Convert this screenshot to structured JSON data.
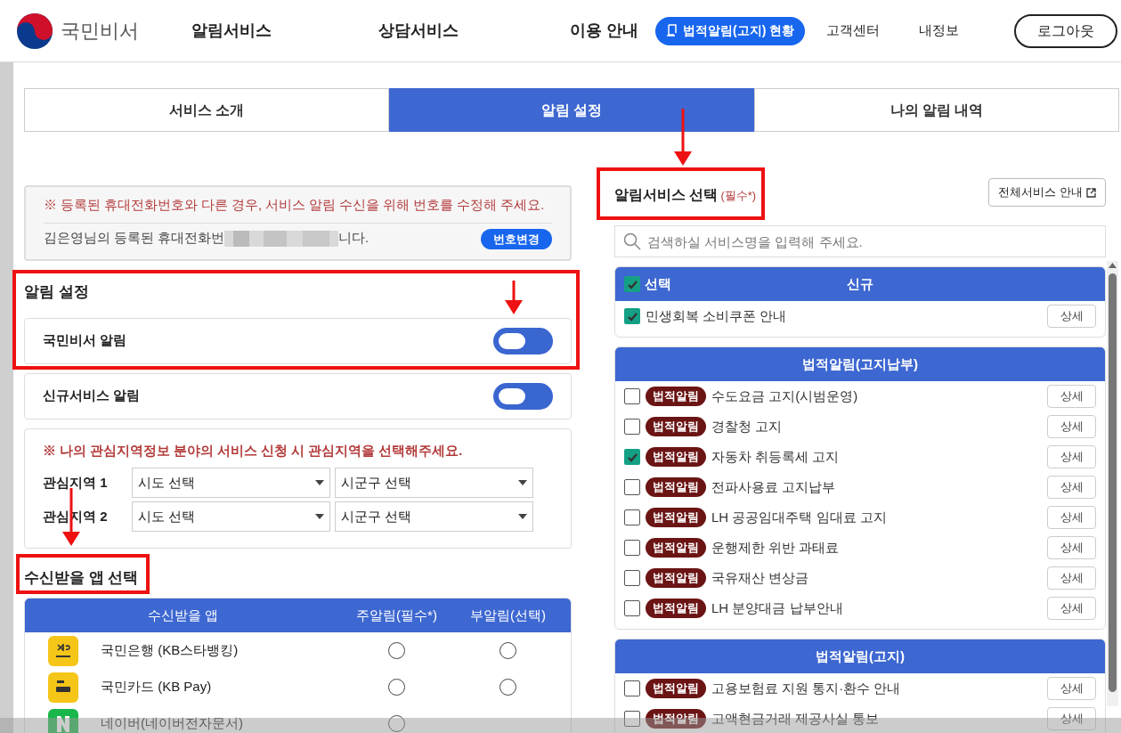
{
  "header": {
    "logo_text": "국민비서",
    "nav": [
      {
        "label": "알림서비스"
      },
      {
        "label": "상담서비스"
      },
      {
        "label": "이용 안내"
      }
    ],
    "status_button": "법적알림(고지) 현황",
    "links": [
      "고객센터",
      "내정보"
    ],
    "logout": "로그아웃"
  },
  "tabs": [
    {
      "label": "서비스 소개",
      "selected": false
    },
    {
      "label": "알림 설정",
      "selected": true
    },
    {
      "label": "나의 알림 내역",
      "selected": false
    }
  ],
  "phone_notice": {
    "warning": "※ 등록된 휴대전화번호와 다른 경우, 서비스 알림 수신을 위해 번호를 수정해 주세요.",
    "text_before": "김은영님의 등록된 휴대전화번",
    "text_after": "니다.",
    "change_button": "번호변경"
  },
  "alert_settings": {
    "title": "알림 설정",
    "toggles": [
      {
        "label": "국민비서 알림",
        "on": false
      },
      {
        "label": "신규서비스 알림",
        "on": false
      }
    ]
  },
  "region": {
    "warning": "※ 나의 관심지역정보 분야의 서비스 신청 시 관심지역을 선택해주세요.",
    "rows": [
      {
        "label": "관심지역 1",
        "selects": [
          "시도 선택",
          "시군구 선택"
        ]
      },
      {
        "label": "관심지역 2",
        "selects": [
          "시도 선택",
          "시군구 선택"
        ]
      }
    ]
  },
  "app_select": {
    "title": "수신받을 앱 선택",
    "columns": [
      "수신받을 앱",
      "주알림(필수*)",
      "부알림(선택)"
    ],
    "rows": [
      {
        "kind": "kb-bank",
        "name": "국민은행 (KB스타뱅킹)",
        "main_selected": false,
        "sub_selected": false
      },
      {
        "kind": "kb-pay",
        "name": "국민카드 (KB Pay)",
        "main_selected": false,
        "sub_selected": false
      },
      {
        "kind": "naver",
        "name": "네이버(네이버전자문서)",
        "main_selected": false
      }
    ]
  },
  "service_select": {
    "title": "알림서비스 선택",
    "required": "(필수*)",
    "guide_button": "전체서비스 안내",
    "search": {
      "placeholder": "검색하실 서비스명을 입력해 주세요."
    },
    "groups": [
      {
        "title": "신규",
        "select_all": {
          "label": "선택",
          "checked": true
        },
        "items": [
          {
            "label": "민생회복 소비쿠폰 안내",
            "checked": true,
            "detail": "상세"
          }
        ]
      },
      {
        "title": "법적알림(고지납부)",
        "items": [
          {
            "badge": "법적알림",
            "label": "수도요금 고지(시범운영)",
            "checked": false,
            "detail": "상세"
          },
          {
            "badge": "법적알림",
            "label": "경찰청 고지",
            "checked": false,
            "detail": "상세"
          },
          {
            "badge": "법적알림",
            "label": "자동차 취등록세 고지",
            "checked": true,
            "detail": "상세"
          },
          {
            "badge": "법적알림",
            "label": "전파사용료 고지납부",
            "checked": false,
            "detail": "상세"
          },
          {
            "badge": "법적알림",
            "label": "LH 공공임대주택 임대료 고지",
            "checked": false,
            "detail": "상세"
          },
          {
            "badge": "법적알림",
            "label": "운행제한 위반 과태료",
            "checked": false,
            "detail": "상세"
          },
          {
            "badge": "법적알림",
            "label": "국유재산 변상금",
            "checked": false,
            "detail": "상세"
          },
          {
            "badge": "법적알림",
            "label": "LH 분양대금 납부안내",
            "checked": false,
            "detail": "상세"
          }
        ]
      },
      {
        "title": "법적알림(고지)",
        "items": [
          {
            "badge": "법적알림",
            "label": "고용보험료 지원 통지·환수 안내",
            "checked": false,
            "detail": "상세"
          },
          {
            "badge": "법적알림",
            "label": "고액현금거래 제공사실 통보",
            "checked": false,
            "detail": "상세"
          }
        ]
      }
    ]
  }
}
